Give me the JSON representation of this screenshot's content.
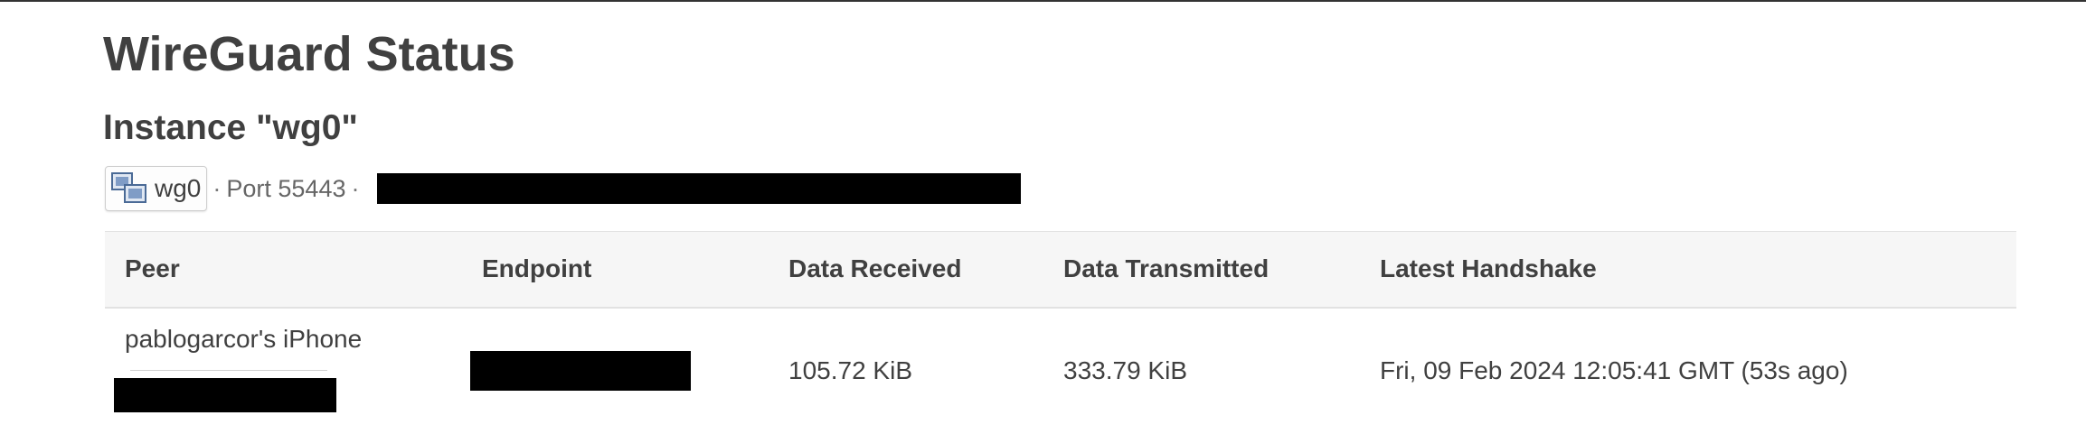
{
  "page": {
    "title": "WireGuard Status"
  },
  "instance": {
    "title": "Instance \"wg0\"",
    "interface_name": "wg0",
    "interface_icon": "network-interface-icon",
    "separator": "·",
    "port_label": "Port 55443"
  },
  "table": {
    "headers": {
      "peer": "Peer",
      "endpoint": "Endpoint",
      "data_received": "Data Received",
      "data_transmitted": "Data Transmitted",
      "latest_handshake": "Latest Handshake"
    },
    "rows": [
      {
        "peer_name": "pablogarcor's iPhone",
        "data_received": "105.72 KiB",
        "data_transmitted": "333.79 KiB",
        "latest_handshake": "Fri, 09 Feb 2024 12:05:41 GMT (53s ago)"
      }
    ]
  },
  "colors": {
    "text": "#404040",
    "muted": "#666666",
    "header_bg": "#f6f6f6",
    "redaction": "#000000"
  }
}
